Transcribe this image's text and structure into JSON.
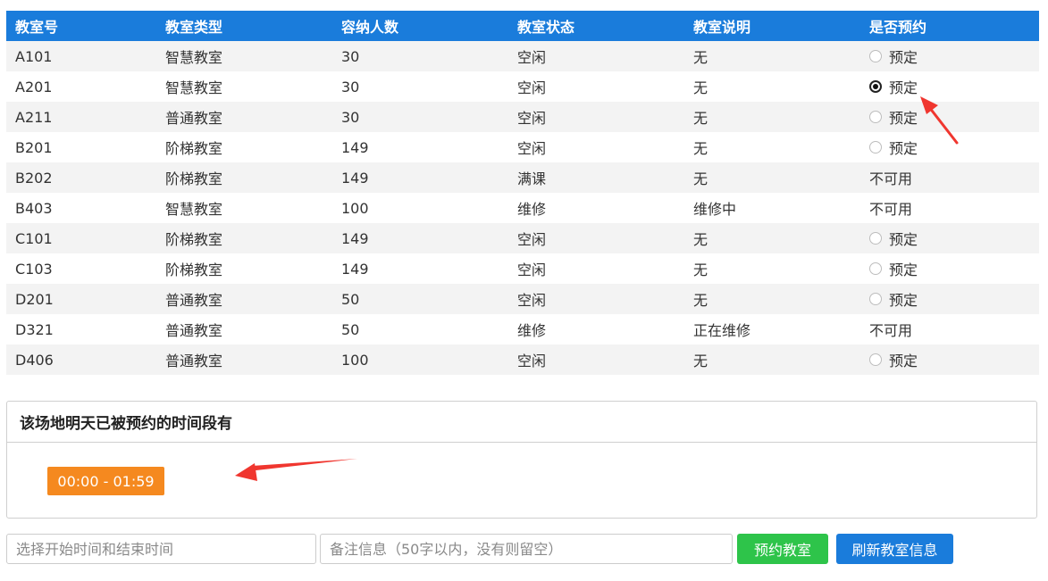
{
  "table": {
    "headers": [
      "教室号",
      "教室类型",
      "容纳人数",
      "教室状态",
      "教室说明",
      "是否预约"
    ],
    "rows": [
      {
        "room": "A101",
        "type": "智慧教室",
        "capacity": "30",
        "status": "空闲",
        "note": "无",
        "reserve": "预定",
        "reservable": true,
        "checked": false
      },
      {
        "room": "A201",
        "type": "智慧教室",
        "capacity": "30",
        "status": "空闲",
        "note": "无",
        "reserve": "预定",
        "reservable": true,
        "checked": true
      },
      {
        "room": "A211",
        "type": "普通教室",
        "capacity": "30",
        "status": "空闲",
        "note": "无",
        "reserve": "预定",
        "reservable": true,
        "checked": false
      },
      {
        "room": "B201",
        "type": "阶梯教室",
        "capacity": "149",
        "status": "空闲",
        "note": "无",
        "reserve": "预定",
        "reservable": true,
        "checked": false
      },
      {
        "room": "B202",
        "type": "阶梯教室",
        "capacity": "149",
        "status": "满课",
        "note": "无",
        "reserve": "不可用",
        "reservable": false,
        "checked": false
      },
      {
        "room": "B403",
        "type": "智慧教室",
        "capacity": "100",
        "status": "维修",
        "note": "维修中",
        "reserve": "不可用",
        "reservable": false,
        "checked": false
      },
      {
        "room": "C101",
        "type": "阶梯教室",
        "capacity": "149",
        "status": "空闲",
        "note": "无",
        "reserve": "预定",
        "reservable": true,
        "checked": false
      },
      {
        "room": "C103",
        "type": "阶梯教室",
        "capacity": "149",
        "status": "空闲",
        "note": "无",
        "reserve": "预定",
        "reservable": true,
        "checked": false
      },
      {
        "room": "D201",
        "type": "普通教室",
        "capacity": "50",
        "status": "空闲",
        "note": "无",
        "reserve": "预定",
        "reservable": true,
        "checked": false
      },
      {
        "room": "D321",
        "type": "普通教室",
        "capacity": "50",
        "status": "维修",
        "note": "正在维修",
        "reserve": "不可用",
        "reservable": false,
        "checked": false
      },
      {
        "room": "D406",
        "type": "普通教室",
        "capacity": "100",
        "status": "空闲",
        "note": "无",
        "reserve": "预定",
        "reservable": true,
        "checked": false
      }
    ]
  },
  "booked_panel": {
    "title": "该场地明天已被预约的时间段有",
    "slots": [
      "00:00 - 01:59"
    ]
  },
  "form": {
    "time_placeholder": "选择开始时间和结束时间",
    "note_placeholder": "备注信息（50字以内，没有则留空）",
    "reserve_button": "预约教室",
    "refresh_button": "刷新教室信息"
  },
  "colors": {
    "header_bg": "#1a7cdb",
    "slot_badge": "#f5891f",
    "reserve_button": "#2ec44a",
    "refresh_button": "#1a7cdb",
    "annotation_arrow": "#f0362f"
  }
}
